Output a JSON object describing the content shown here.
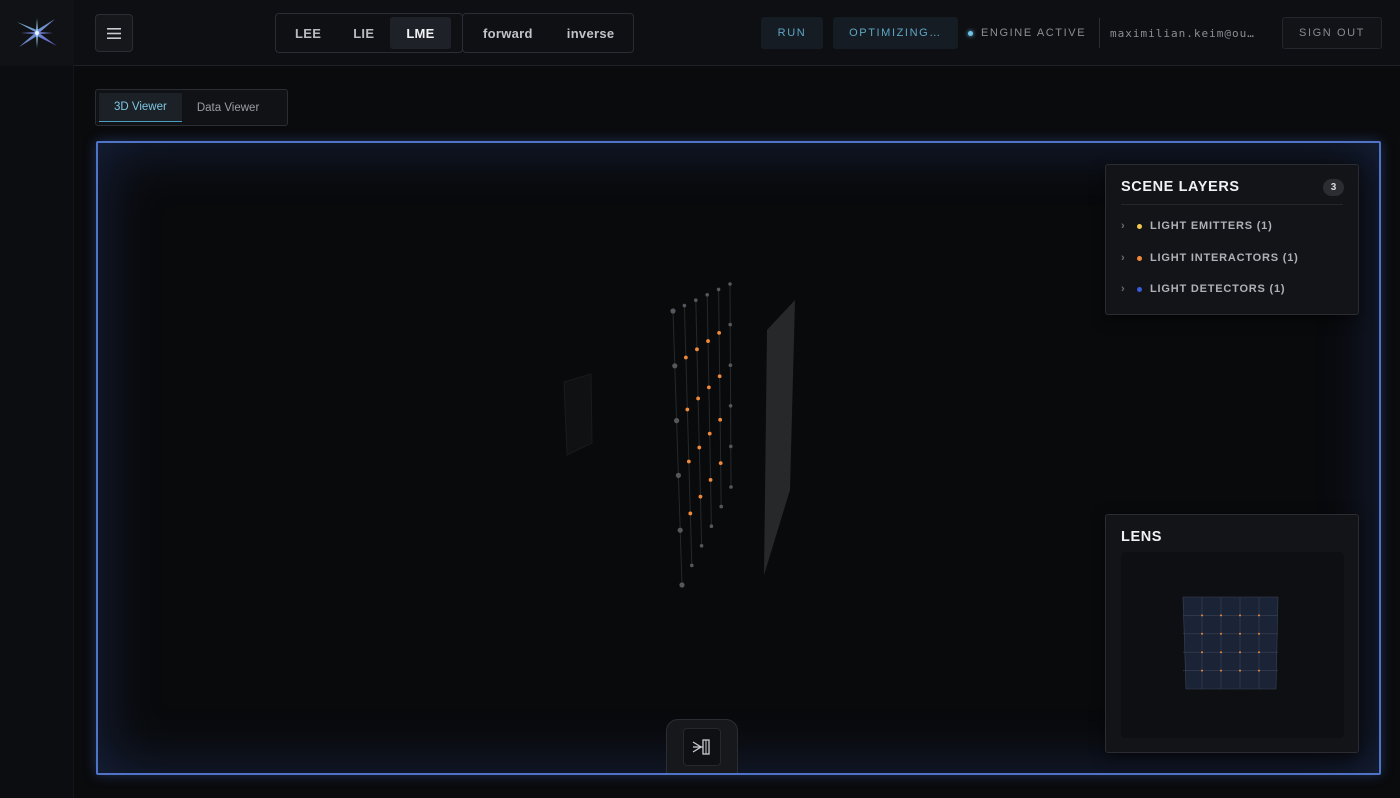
{
  "header": {
    "mode_tabs": [
      {
        "label": "LEE",
        "active": false
      },
      {
        "label": "LIE",
        "active": false
      },
      {
        "label": "LME",
        "active": true
      }
    ],
    "direction_tabs": [
      {
        "label": "forward",
        "active": false
      },
      {
        "label": "inverse",
        "active": false
      }
    ],
    "run_label": "RUN",
    "optimizing_label": "OPTIMIZING…",
    "engine_status": "ENGINE ACTIVE",
    "user_email": "maximilian.keim@ou…",
    "sign_out_label": "SIGN OUT"
  },
  "view_tabs": [
    {
      "label": "3D Viewer",
      "active": true
    },
    {
      "label": "Data Viewer",
      "active": false
    }
  ],
  "scene_layers": {
    "title": "SCENE LAYERS",
    "count": "3",
    "items": [
      {
        "label": "LIGHT EMITTERS (1)",
        "color": "#f2c94c"
      },
      {
        "label": "LIGHT INTERACTORS (1)",
        "color": "#f08a3a"
      },
      {
        "label": "LIGHT DETECTORS (1)",
        "color": "#3b5bdb"
      }
    ]
  },
  "lens": {
    "title": "LENS"
  },
  "colors": {
    "accent_blue": "#4f73c6",
    "active_cyan": "#7ec6e0",
    "interactor_orange": "#f08a3a"
  },
  "icons": {
    "logo": "starburst-logo",
    "menu": "hamburger-menu-icon",
    "tool": "beam-splitter-icon",
    "chevron": "chevron-right-icon"
  }
}
